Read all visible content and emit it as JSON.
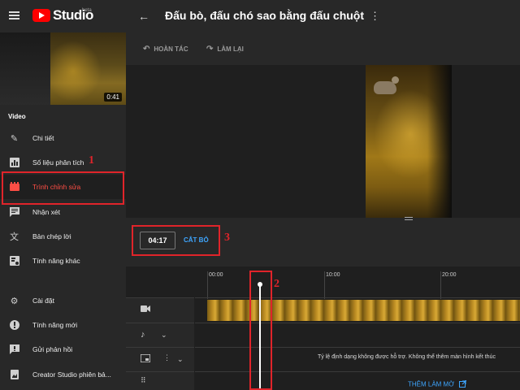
{
  "app": {
    "name": "Studio",
    "beta": "beta"
  },
  "header": {
    "title": "Đấu bò, đấu chó sao bằng đấu chuột"
  },
  "video_thumb": {
    "duration": "0:41"
  },
  "sidebar": {
    "section": "Video",
    "items": [
      {
        "label": "Chi tiết",
        "icon": "pencil-icon"
      },
      {
        "label": "Số liệu phân tích",
        "icon": "analytics-icon"
      },
      {
        "label": "Trình chỉnh sửa",
        "icon": "editor-icon",
        "active": true
      },
      {
        "label": "Nhận xét",
        "icon": "comments-icon"
      },
      {
        "label": "Bản chép lời",
        "icon": "subtitles-icon"
      },
      {
        "label": "Tính năng khác",
        "icon": "other-features-icon"
      },
      {
        "label": "Cài đặt",
        "icon": "settings-icon"
      },
      {
        "label": "Tính năng mới",
        "icon": "whats-new-icon"
      },
      {
        "label": "Gửi phản hồi",
        "icon": "feedback-icon"
      },
      {
        "label": "Creator Studio phiên bả...",
        "icon": "classic-studio-icon"
      }
    ]
  },
  "toolbar": {
    "undo": "HOÀN TÁC",
    "redo": "LÀM LẠI"
  },
  "trim": {
    "time": "04:17",
    "button": "CẮT BỎ"
  },
  "timeline": {
    "ruler": [
      "00:00",
      "10:00",
      "20:00"
    ],
    "note": "Tỷ lệ định dạng không được hỗ trợ. Không thể thêm màn hình kết thúc",
    "blur_button": "THÊM LÀM MỜ"
  },
  "annotations": [
    "1",
    "2",
    "3"
  ],
  "colors": {
    "accent_red": "#ff4e45",
    "link_blue": "#3ea6ff",
    "annotation_red": "#e0242a"
  }
}
